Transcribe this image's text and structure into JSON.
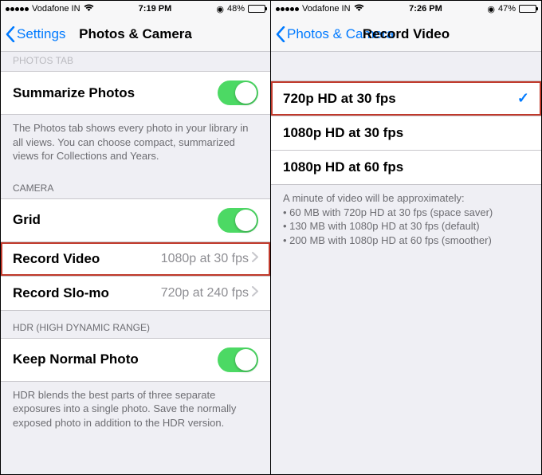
{
  "left": {
    "status": {
      "carrier": "Vodafone IN",
      "time": "7:19 PM",
      "battery_pct": "48%"
    },
    "nav": {
      "back": "Settings",
      "title": "Photos & Camera"
    },
    "partial_section": "PHOTOS TAB",
    "summarize": {
      "label": "Summarize Photos"
    },
    "summarize_footer": "The Photos tab shows every photo in your library in all views. You can choose compact, summarized views for Collections and Years.",
    "camera_header": "CAMERA",
    "grid": {
      "label": "Grid"
    },
    "record_video": {
      "label": "Record Video",
      "value": "1080p at 30 fps"
    },
    "record_slomo": {
      "label": "Record Slo-mo",
      "value": "720p at 240 fps"
    },
    "hdr_header": "HDR (HIGH DYNAMIC RANGE)",
    "keep_normal": {
      "label": "Keep Normal Photo"
    },
    "hdr_footer": "HDR blends the best parts of three separate exposures into a single photo. Save the normally exposed photo in addition to the HDR version."
  },
  "right": {
    "status": {
      "carrier": "Vodafone IN",
      "time": "7:26 PM",
      "battery_pct": "47%"
    },
    "nav": {
      "back": "Photos & Camera",
      "title": "Record Video"
    },
    "options": {
      "opt1": "720p HD at 30 fps",
      "opt2": "1080p HD at 30 fps",
      "opt3": "1080p HD at 60 fps"
    },
    "footer_intro": "A minute of video will be approximately:",
    "footer_line1": "• 60 MB with 720p HD at 30 fps (space saver)",
    "footer_line2": "• 130 MB with 1080p HD at 30 fps (default)",
    "footer_line3": "• 200 MB with 1080p HD at 60 fps (smoother)"
  }
}
